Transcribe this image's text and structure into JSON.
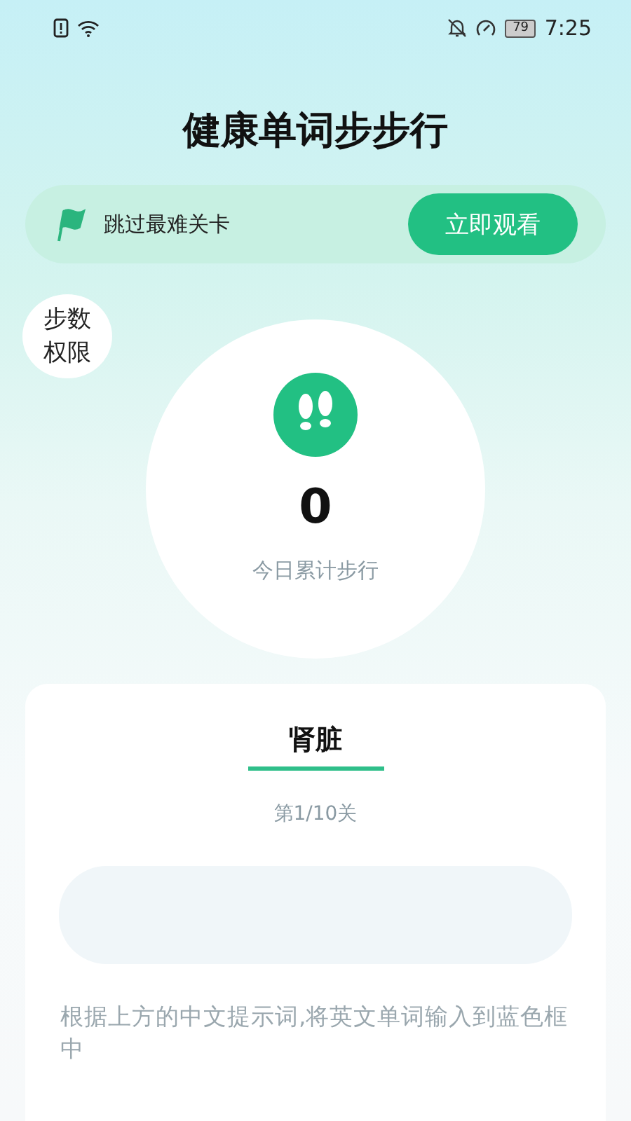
{
  "status_bar": {
    "time": "7:25",
    "battery": "79"
  },
  "title": "健康单词步步行",
  "banner": {
    "text": "跳过最难关卡",
    "button": "立即观看"
  },
  "permission": {
    "line1": "步数",
    "line2": "权限"
  },
  "steps": {
    "count": "0",
    "label": "今日累计步行"
  },
  "quiz": {
    "word": "肾脏",
    "level": "第1/10关",
    "hint": "根据上方的中文提示词,将英文单词输入到蓝色框中"
  }
}
